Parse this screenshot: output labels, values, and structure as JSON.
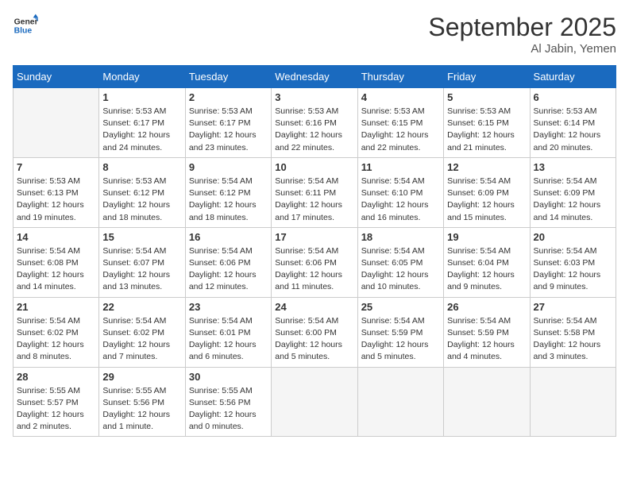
{
  "header": {
    "logo_line1": "General",
    "logo_line2": "Blue",
    "month_title": "September 2025",
    "location": "Al Jabin, Yemen"
  },
  "days_of_week": [
    "Sunday",
    "Monday",
    "Tuesday",
    "Wednesday",
    "Thursday",
    "Friday",
    "Saturday"
  ],
  "weeks": [
    [
      {
        "num": "",
        "info": ""
      },
      {
        "num": "1",
        "info": "Sunrise: 5:53 AM\nSunset: 6:17 PM\nDaylight: 12 hours\nand 24 minutes."
      },
      {
        "num": "2",
        "info": "Sunrise: 5:53 AM\nSunset: 6:17 PM\nDaylight: 12 hours\nand 23 minutes."
      },
      {
        "num": "3",
        "info": "Sunrise: 5:53 AM\nSunset: 6:16 PM\nDaylight: 12 hours\nand 22 minutes."
      },
      {
        "num": "4",
        "info": "Sunrise: 5:53 AM\nSunset: 6:15 PM\nDaylight: 12 hours\nand 22 minutes."
      },
      {
        "num": "5",
        "info": "Sunrise: 5:53 AM\nSunset: 6:15 PM\nDaylight: 12 hours\nand 21 minutes."
      },
      {
        "num": "6",
        "info": "Sunrise: 5:53 AM\nSunset: 6:14 PM\nDaylight: 12 hours\nand 20 minutes."
      }
    ],
    [
      {
        "num": "7",
        "info": "Sunrise: 5:53 AM\nSunset: 6:13 PM\nDaylight: 12 hours\nand 19 minutes."
      },
      {
        "num": "8",
        "info": "Sunrise: 5:53 AM\nSunset: 6:12 PM\nDaylight: 12 hours\nand 18 minutes."
      },
      {
        "num": "9",
        "info": "Sunrise: 5:54 AM\nSunset: 6:12 PM\nDaylight: 12 hours\nand 18 minutes."
      },
      {
        "num": "10",
        "info": "Sunrise: 5:54 AM\nSunset: 6:11 PM\nDaylight: 12 hours\nand 17 minutes."
      },
      {
        "num": "11",
        "info": "Sunrise: 5:54 AM\nSunset: 6:10 PM\nDaylight: 12 hours\nand 16 minutes."
      },
      {
        "num": "12",
        "info": "Sunrise: 5:54 AM\nSunset: 6:09 PM\nDaylight: 12 hours\nand 15 minutes."
      },
      {
        "num": "13",
        "info": "Sunrise: 5:54 AM\nSunset: 6:09 PM\nDaylight: 12 hours\nand 14 minutes."
      }
    ],
    [
      {
        "num": "14",
        "info": "Sunrise: 5:54 AM\nSunset: 6:08 PM\nDaylight: 12 hours\nand 14 minutes."
      },
      {
        "num": "15",
        "info": "Sunrise: 5:54 AM\nSunset: 6:07 PM\nDaylight: 12 hours\nand 13 minutes."
      },
      {
        "num": "16",
        "info": "Sunrise: 5:54 AM\nSunset: 6:06 PM\nDaylight: 12 hours\nand 12 minutes."
      },
      {
        "num": "17",
        "info": "Sunrise: 5:54 AM\nSunset: 6:06 PM\nDaylight: 12 hours\nand 11 minutes."
      },
      {
        "num": "18",
        "info": "Sunrise: 5:54 AM\nSunset: 6:05 PM\nDaylight: 12 hours\nand 10 minutes."
      },
      {
        "num": "19",
        "info": "Sunrise: 5:54 AM\nSunset: 6:04 PM\nDaylight: 12 hours\nand 9 minutes."
      },
      {
        "num": "20",
        "info": "Sunrise: 5:54 AM\nSunset: 6:03 PM\nDaylight: 12 hours\nand 9 minutes."
      }
    ],
    [
      {
        "num": "21",
        "info": "Sunrise: 5:54 AM\nSunset: 6:02 PM\nDaylight: 12 hours\nand 8 minutes."
      },
      {
        "num": "22",
        "info": "Sunrise: 5:54 AM\nSunset: 6:02 PM\nDaylight: 12 hours\nand 7 minutes."
      },
      {
        "num": "23",
        "info": "Sunrise: 5:54 AM\nSunset: 6:01 PM\nDaylight: 12 hours\nand 6 minutes."
      },
      {
        "num": "24",
        "info": "Sunrise: 5:54 AM\nSunset: 6:00 PM\nDaylight: 12 hours\nand 5 minutes."
      },
      {
        "num": "25",
        "info": "Sunrise: 5:54 AM\nSunset: 5:59 PM\nDaylight: 12 hours\nand 5 minutes."
      },
      {
        "num": "26",
        "info": "Sunrise: 5:54 AM\nSunset: 5:59 PM\nDaylight: 12 hours\nand 4 minutes."
      },
      {
        "num": "27",
        "info": "Sunrise: 5:54 AM\nSunset: 5:58 PM\nDaylight: 12 hours\nand 3 minutes."
      }
    ],
    [
      {
        "num": "28",
        "info": "Sunrise: 5:55 AM\nSunset: 5:57 PM\nDaylight: 12 hours\nand 2 minutes."
      },
      {
        "num": "29",
        "info": "Sunrise: 5:55 AM\nSunset: 5:56 PM\nDaylight: 12 hours\nand 1 minute."
      },
      {
        "num": "30",
        "info": "Sunrise: 5:55 AM\nSunset: 5:56 PM\nDaylight: 12 hours\nand 0 minutes."
      },
      {
        "num": "",
        "info": ""
      },
      {
        "num": "",
        "info": ""
      },
      {
        "num": "",
        "info": ""
      },
      {
        "num": "",
        "info": ""
      }
    ]
  ]
}
